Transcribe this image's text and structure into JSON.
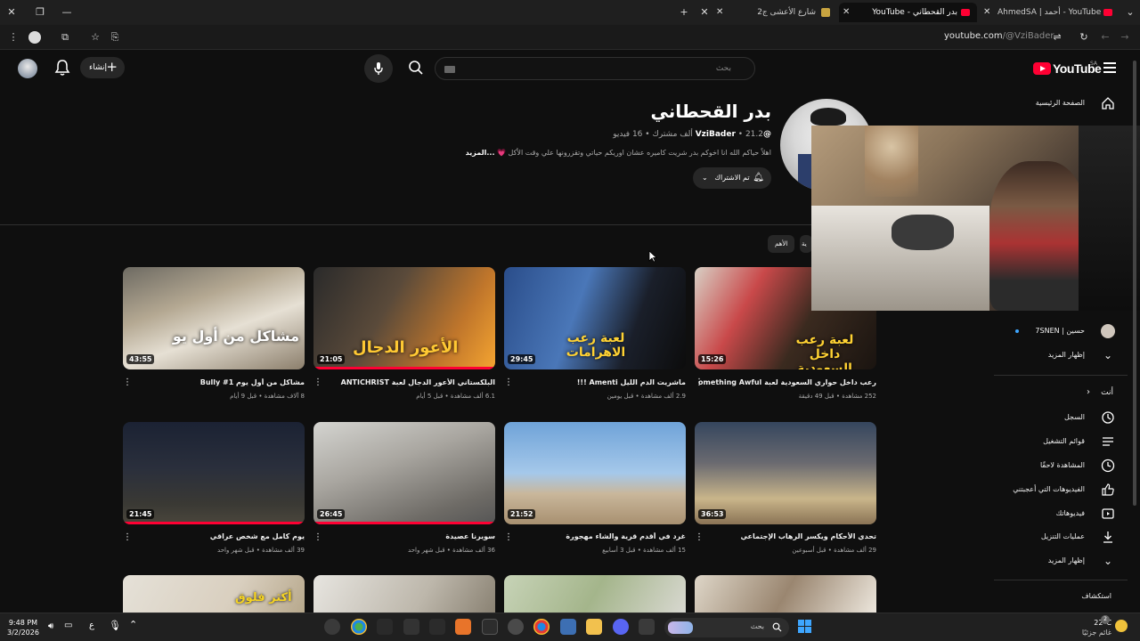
{
  "browser": {
    "tabs": [
      {
        "title": "YouTube - أحمد | AhmedSA"
      },
      {
        "title": "بدر القحطاني - YouTube"
      },
      {
        "title": "شارع الأعشى ج2"
      }
    ],
    "url_domain": "youtube.com",
    "url_path": "/@VziBader"
  },
  "header": {
    "logo_text": "YouTube",
    "logo_region": "SA",
    "search_placeholder": "بحث",
    "create_label": "إنشاء"
  },
  "channel": {
    "name": "بدر القحطاني",
    "handle": "@VziBader",
    "subscribers": "21.2 ألف مشترك",
    "videos": "16 فيديو",
    "description": "اهلاً حياكم الله انا اخوكم بدر شريت كاميره عشان اوريكم حياتي وتقزرونها علي وقت الأكل 💗",
    "more_link": "...المزيد",
    "subscribed_label": "تم الاشتراك"
  },
  "chips": [
    {
      "label": "الأهم"
    },
    {
      "label": "ية"
    }
  ],
  "videos": [
    {
      "title": "مشاكل من أول يوم Bully #1",
      "views": "8 آلاف مشاهدة",
      "age": "قبل 9 أيام",
      "duration": "43:55",
      "progress": 0
    },
    {
      "title": "البلكستاني الأعور الدجال لعبة ANTICHRIST",
      "views": "6.1 ألف مشاهدة",
      "age": "قبل 5 أيام",
      "duration": "21:05",
      "progress": 1
    },
    {
      "title": "ماشريت الدم الليل Amenti !!!",
      "views": "2.9 ألف مشاهدة",
      "age": "قبل يومين",
      "duration": "29:45",
      "progress": 0
    },
    {
      "title": "رعب داخل حواري السعودية لعبة Something Awful",
      "views": "252 مشاهدة",
      "age": "قبل 49 دقيقة",
      "duration": "15:26",
      "progress": 0
    },
    {
      "title": "يوم كامل مع شخص عراقي",
      "views": "39 ألف مشاهدة",
      "age": "قبل شهر واحد",
      "duration": "21:45",
      "progress": 1
    },
    {
      "title": "سويرنا عصيدة",
      "views": "36 ألف مشاهدة",
      "age": "قبل شهر واحد",
      "duration": "26:45",
      "progress": 1
    },
    {
      "title": "غرد في أقدم قرية والشاء مهجورة",
      "views": "15 ألف مشاهدة",
      "age": "قبل 3 أسابيع",
      "duration": "21:52",
      "progress": 0
    },
    {
      "title": "تحدي الأحكام ويكسر الرهاب الإجتماعي",
      "views": "29 ألف مشاهدة",
      "age": "قبل أسبوعين",
      "duration": "36:53",
      "progress": 0
    }
  ],
  "thumb_texts": [
    "مشاكل من أول يو",
    "الأعور الدجال",
    "لعبة رعب الاهرامات",
    "لعبة رعب داخل السعودية",
    "",
    "",
    "",
    "",
    "أكثر فلوق",
    "",
    "",
    ""
  ],
  "sidebar": {
    "top_items": [
      {
        "label": "الصفحة الرئيسية",
        "icon": "home-icon"
      }
    ],
    "subs_items": [
      {
        "label": "حسين | 7SNEN"
      }
    ],
    "show_more_1": "إظهار المزيد",
    "you_header": "أنت",
    "you_items": [
      {
        "label": "السجل",
        "icon": "history-icon"
      },
      {
        "label": "قوائم التشغيل",
        "icon": "playlist-icon"
      },
      {
        "label": "المشاهدة لاحقًا",
        "icon": "clock-icon"
      },
      {
        "label": "الفيديوهات التي أعجبتني",
        "icon": "thumb-up-icon"
      },
      {
        "label": "فيديوهاتك",
        "icon": "video-icon"
      },
      {
        "label": "عمليات التنزيل",
        "icon": "download-icon"
      }
    ],
    "show_more_2": "إظهار المزيد",
    "explore_header": "استكشاف"
  },
  "taskbar": {
    "time": "9:48 PM",
    "date": "3/2/2026",
    "search_label": "بحث",
    "weather_temp": "22°C",
    "weather_desc": "غائم جزئيًا",
    "lang": "ع",
    "notif_count": "2"
  }
}
